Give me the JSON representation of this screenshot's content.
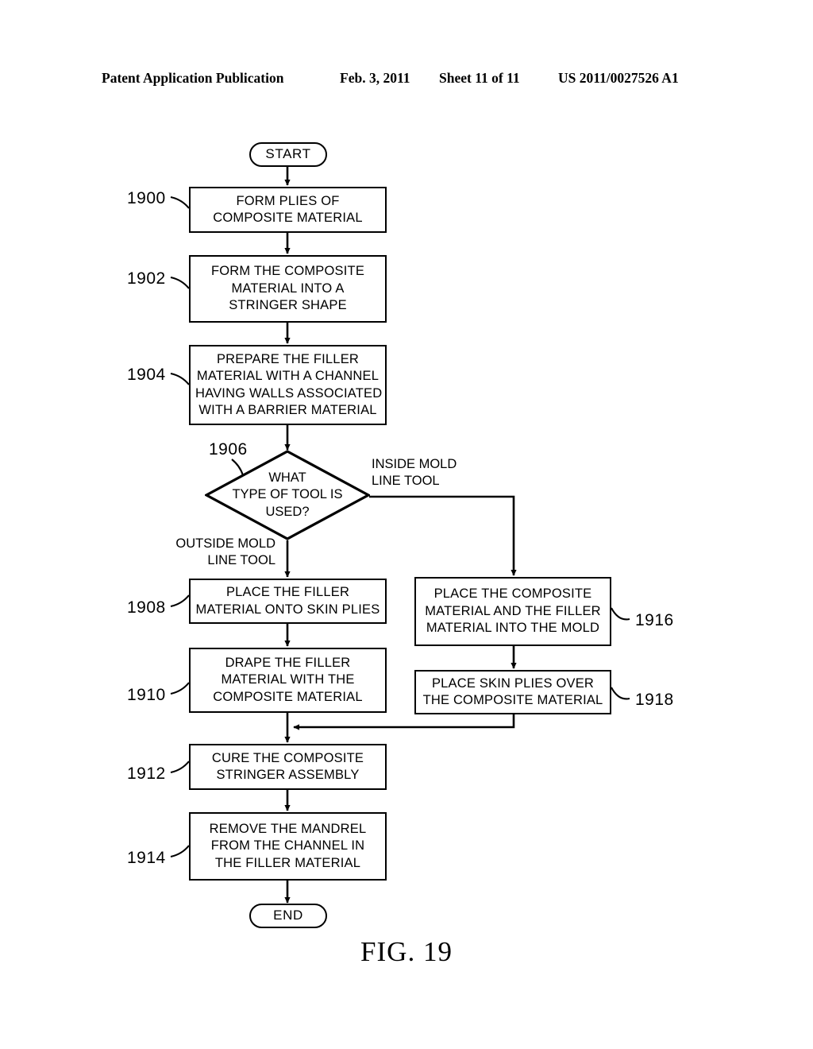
{
  "header": {
    "publication": "Patent Application Publication",
    "date": "Feb. 3, 2011",
    "sheet": "Sheet 11 of 11",
    "number": "US 2011/0027526 A1"
  },
  "figure": {
    "caption": "FIG. 19"
  },
  "flowchart": {
    "start": {
      "label": "START"
    },
    "end": {
      "label": "END"
    },
    "steps": [
      {
        "ref": "1900",
        "lines": [
          "FORM PLIES OF",
          "COMPOSITE MATERIAL"
        ]
      },
      {
        "ref": "1902",
        "lines": [
          "FORM THE COMPOSITE",
          "MATERIAL INTO A",
          "STRINGER SHAPE"
        ]
      },
      {
        "ref": "1904",
        "lines": [
          "PREPARE THE FILLER",
          "MATERIAL WITH A CHANNEL",
          "HAVING WALLS ASSOCIATED",
          "WITH A BARRIER MATERIAL"
        ]
      },
      {
        "ref": "1908",
        "lines": [
          "PLACE THE FILLER",
          "MATERIAL ONTO SKIN PLIES"
        ]
      },
      {
        "ref": "1910",
        "lines": [
          "DRAPE THE FILLER",
          "MATERIAL WITH THE",
          "COMPOSITE MATERIAL"
        ]
      },
      {
        "ref": "1912",
        "lines": [
          "CURE THE COMPOSITE",
          "STRINGER ASSEMBLY"
        ]
      },
      {
        "ref": "1914",
        "lines": [
          "REMOVE THE MANDREL",
          "FROM THE CHANNEL IN",
          "THE FILLER MATERIAL"
        ]
      },
      {
        "ref": "1916",
        "lines": [
          "PLACE THE COMPOSITE",
          "MATERIAL AND THE FILLER",
          "MATERIAL INTO THE MOLD"
        ]
      },
      {
        "ref": "1918",
        "lines": [
          "PLACE SKIN PLIES OVER",
          "THE COMPOSITE MATERIAL"
        ]
      }
    ],
    "decision": {
      "ref": "1906",
      "lines": [
        "WHAT",
        "TYPE OF TOOL IS",
        "USED?"
      ]
    },
    "branch_labels": {
      "outside": [
        "OUTSIDE MOLD",
        "LINE TOOL"
      ],
      "inside": [
        "INSIDE MOLD",
        "LINE TOOL"
      ]
    }
  },
  "style": {
    "ink": "#000000",
    "paper": "#ffffff"
  }
}
